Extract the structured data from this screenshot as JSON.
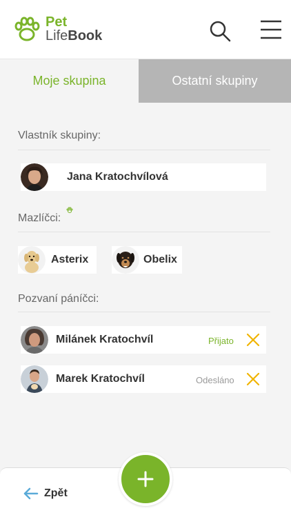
{
  "header": {
    "brand_line1": "Pet",
    "brand_line2_a": "Life",
    "brand_line2_b": "Book",
    "icons": [
      "paw-logo-icon",
      "search-icon",
      "menu-icon"
    ]
  },
  "tabs": [
    {
      "label": "Moje skupina",
      "active": true
    },
    {
      "label": "Ostatní skupiny",
      "active": false
    }
  ],
  "owner_section": {
    "label": "Vlastník skupiny:",
    "owner_name": "Jana Kratochvílová"
  },
  "pets_section": {
    "label": "Mazlíčci:",
    "pets": [
      {
        "name": "Asterix"
      },
      {
        "name": "Obelix"
      }
    ]
  },
  "invited_section": {
    "label": "Pozvaní páníčci:",
    "people": [
      {
        "name": "Milánek Kratochvíl",
        "status": "Přijato"
      },
      {
        "name": "Marek Kratochvíl",
        "status": "Odesláno"
      }
    ]
  },
  "bottom": {
    "back_label": "Zpět"
  },
  "colors": {
    "accent": "#7ab42a",
    "close": "#f0b400",
    "back_arrow": "#5aaad8",
    "status_accepted": "#7ab42a",
    "status_sent": "#9a9a9a"
  }
}
